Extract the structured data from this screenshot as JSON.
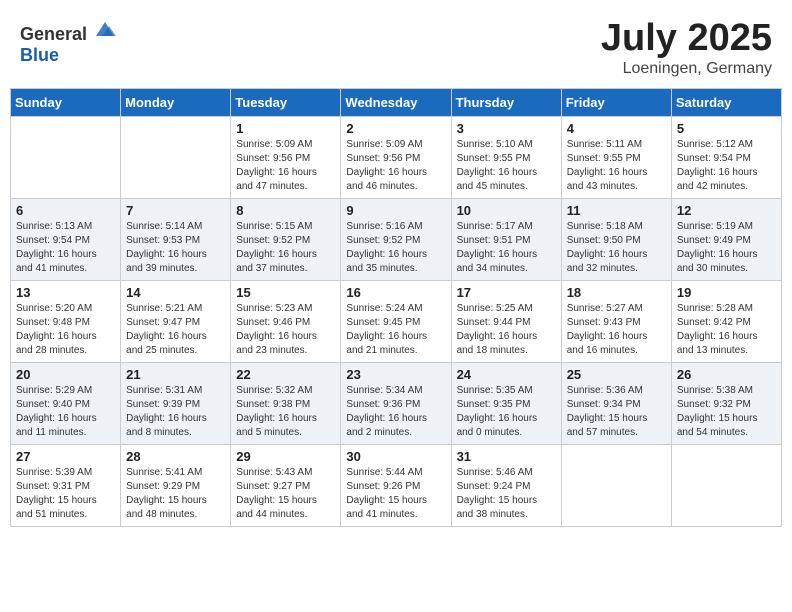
{
  "header": {
    "logo_general": "General",
    "logo_blue": "Blue",
    "month": "July 2025",
    "location": "Loeningen, Germany"
  },
  "days_of_week": [
    "Sunday",
    "Monday",
    "Tuesday",
    "Wednesday",
    "Thursday",
    "Friday",
    "Saturday"
  ],
  "weeks": [
    [
      {
        "day": "",
        "info": ""
      },
      {
        "day": "",
        "info": ""
      },
      {
        "day": "1",
        "info": "Sunrise: 5:09 AM\nSunset: 9:56 PM\nDaylight: 16 hours and 47 minutes."
      },
      {
        "day": "2",
        "info": "Sunrise: 5:09 AM\nSunset: 9:56 PM\nDaylight: 16 hours and 46 minutes."
      },
      {
        "day": "3",
        "info": "Sunrise: 5:10 AM\nSunset: 9:55 PM\nDaylight: 16 hours and 45 minutes."
      },
      {
        "day": "4",
        "info": "Sunrise: 5:11 AM\nSunset: 9:55 PM\nDaylight: 16 hours and 43 minutes."
      },
      {
        "day": "5",
        "info": "Sunrise: 5:12 AM\nSunset: 9:54 PM\nDaylight: 16 hours and 42 minutes."
      }
    ],
    [
      {
        "day": "6",
        "info": "Sunrise: 5:13 AM\nSunset: 9:54 PM\nDaylight: 16 hours and 41 minutes."
      },
      {
        "day": "7",
        "info": "Sunrise: 5:14 AM\nSunset: 9:53 PM\nDaylight: 16 hours and 39 minutes."
      },
      {
        "day": "8",
        "info": "Sunrise: 5:15 AM\nSunset: 9:52 PM\nDaylight: 16 hours and 37 minutes."
      },
      {
        "day": "9",
        "info": "Sunrise: 5:16 AM\nSunset: 9:52 PM\nDaylight: 16 hours and 35 minutes."
      },
      {
        "day": "10",
        "info": "Sunrise: 5:17 AM\nSunset: 9:51 PM\nDaylight: 16 hours and 34 minutes."
      },
      {
        "day": "11",
        "info": "Sunrise: 5:18 AM\nSunset: 9:50 PM\nDaylight: 16 hours and 32 minutes."
      },
      {
        "day": "12",
        "info": "Sunrise: 5:19 AM\nSunset: 9:49 PM\nDaylight: 16 hours and 30 minutes."
      }
    ],
    [
      {
        "day": "13",
        "info": "Sunrise: 5:20 AM\nSunset: 9:48 PM\nDaylight: 16 hours and 28 minutes."
      },
      {
        "day": "14",
        "info": "Sunrise: 5:21 AM\nSunset: 9:47 PM\nDaylight: 16 hours and 25 minutes."
      },
      {
        "day": "15",
        "info": "Sunrise: 5:23 AM\nSunset: 9:46 PM\nDaylight: 16 hours and 23 minutes."
      },
      {
        "day": "16",
        "info": "Sunrise: 5:24 AM\nSunset: 9:45 PM\nDaylight: 16 hours and 21 minutes."
      },
      {
        "day": "17",
        "info": "Sunrise: 5:25 AM\nSunset: 9:44 PM\nDaylight: 16 hours and 18 minutes."
      },
      {
        "day": "18",
        "info": "Sunrise: 5:27 AM\nSunset: 9:43 PM\nDaylight: 16 hours and 16 minutes."
      },
      {
        "day": "19",
        "info": "Sunrise: 5:28 AM\nSunset: 9:42 PM\nDaylight: 16 hours and 13 minutes."
      }
    ],
    [
      {
        "day": "20",
        "info": "Sunrise: 5:29 AM\nSunset: 9:40 PM\nDaylight: 16 hours and 11 minutes."
      },
      {
        "day": "21",
        "info": "Sunrise: 5:31 AM\nSunset: 9:39 PM\nDaylight: 16 hours and 8 minutes."
      },
      {
        "day": "22",
        "info": "Sunrise: 5:32 AM\nSunset: 9:38 PM\nDaylight: 16 hours and 5 minutes."
      },
      {
        "day": "23",
        "info": "Sunrise: 5:34 AM\nSunset: 9:36 PM\nDaylight: 16 hours and 2 minutes."
      },
      {
        "day": "24",
        "info": "Sunrise: 5:35 AM\nSunset: 9:35 PM\nDaylight: 16 hours and 0 minutes."
      },
      {
        "day": "25",
        "info": "Sunrise: 5:36 AM\nSunset: 9:34 PM\nDaylight: 15 hours and 57 minutes."
      },
      {
        "day": "26",
        "info": "Sunrise: 5:38 AM\nSunset: 9:32 PM\nDaylight: 15 hours and 54 minutes."
      }
    ],
    [
      {
        "day": "27",
        "info": "Sunrise: 5:39 AM\nSunset: 9:31 PM\nDaylight: 15 hours and 51 minutes."
      },
      {
        "day": "28",
        "info": "Sunrise: 5:41 AM\nSunset: 9:29 PM\nDaylight: 15 hours and 48 minutes."
      },
      {
        "day": "29",
        "info": "Sunrise: 5:43 AM\nSunset: 9:27 PM\nDaylight: 15 hours and 44 minutes."
      },
      {
        "day": "30",
        "info": "Sunrise: 5:44 AM\nSunset: 9:26 PM\nDaylight: 15 hours and 41 minutes."
      },
      {
        "day": "31",
        "info": "Sunrise: 5:46 AM\nSunset: 9:24 PM\nDaylight: 15 hours and 38 minutes."
      },
      {
        "day": "",
        "info": ""
      },
      {
        "day": "",
        "info": ""
      }
    ]
  ]
}
